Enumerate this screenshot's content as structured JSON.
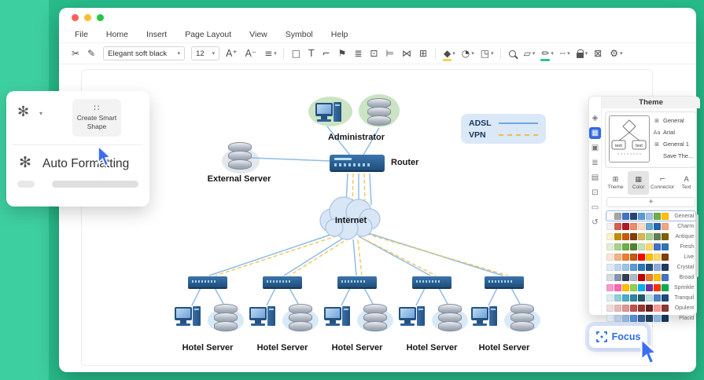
{
  "menu": {
    "items": [
      "File",
      "Home",
      "Insert",
      "Page Layout",
      "View",
      "Symbol",
      "Help"
    ]
  },
  "toolbar": {
    "font_family": "Elegant soft black",
    "font_size": "12",
    "caret": "▾",
    "items_left": [
      {
        "name": "cut-icon",
        "g": "✂",
        "c": ""
      },
      {
        "name": "format-painter-icon",
        "g": "✎",
        "c": ""
      }
    ],
    "items": [
      {
        "name": "increase-font-icon",
        "g": "A⁺",
        "c": ""
      },
      {
        "name": "decrease-font-icon",
        "g": "A⁻",
        "c": ""
      },
      {
        "name": "text-align-icon",
        "g": "≡",
        "c": "▾"
      },
      {
        "name": "toolbar-divider",
        "g": "",
        "c": "",
        "cls": "tb-sep"
      },
      {
        "name": "shape-tool-icon",
        "g": "□",
        "c": ""
      },
      {
        "name": "text-tool-icon",
        "g": "T",
        "c": ""
      },
      {
        "name": "connector-tool-icon",
        "g": "⌐",
        "c": ""
      },
      {
        "name": "flag-tool-icon",
        "g": "⚑",
        "c": ""
      },
      {
        "name": "layers-icon",
        "g": "≣",
        "c": ""
      },
      {
        "name": "select-area-icon",
        "g": "⊡",
        "c": ""
      },
      {
        "name": "align-objects-icon",
        "g": "⊨",
        "c": ""
      },
      {
        "name": "mirror-icon",
        "g": "⋈",
        "c": ""
      },
      {
        "name": "frame-icon",
        "g": "⊞",
        "c": ""
      },
      {
        "name": "toolbar-divider",
        "g": "",
        "c": "",
        "cls": "tb-sep"
      },
      {
        "name": "fill-color-icon",
        "g": "◆",
        "c": "▾",
        "cls": "ic-fill"
      },
      {
        "name": "shadow-icon",
        "g": "◔",
        "c": "▾"
      },
      {
        "name": "crop-icon",
        "g": "◳",
        "c": "▾"
      },
      {
        "name": "toolbar-divider",
        "g": "",
        "c": "",
        "cls": "tb-sep"
      },
      {
        "name": "search-icon",
        "g": "",
        "c": "",
        "cls": "ic-mag"
      },
      {
        "name": "eraser-icon",
        "g": "▱",
        "c": "▾"
      },
      {
        "name": "pen-icon",
        "g": "✏",
        "c": "▾",
        "cls": "ic-pen"
      },
      {
        "name": "line-style-icon",
        "g": "┄",
        "c": "▾"
      },
      {
        "name": "lock-icon",
        "g": "",
        "c": "▾",
        "cls": "ic-lock"
      },
      {
        "name": "export-icon",
        "g": "⊠",
        "c": ""
      },
      {
        "name": "settings-icon",
        "g": "⚙",
        "c": "▾"
      }
    ]
  },
  "smart_popup": {
    "spark_glyph": "✻",
    "caret": "▾",
    "dots_glyph": "∷",
    "create_smart_shape": "Create Smart Shape",
    "auto_formatting": "Auto Formatting"
  },
  "diagram": {
    "administrator": "Administrator",
    "external_server": "External Server",
    "router": "Router",
    "internet": "Internet",
    "adsl": "ADSL",
    "vpn": "VPN",
    "hotel_labels": [
      "Hotel Server",
      "Hotel Server",
      "Hotel Server",
      "Hotel Server",
      "Hotel Server"
    ]
  },
  "theme_panel": {
    "title": "Theme",
    "add_label": "+",
    "preview_shape_text": "text",
    "strip_icons": [
      {
        "name": "symbols-panel-icon",
        "g": "◈"
      },
      {
        "name": "theme-panel-icon",
        "g": "▦",
        "cls": "active"
      },
      {
        "name": "image-panel-icon",
        "g": "▣"
      },
      {
        "name": "layers-panel-icon",
        "g": "≣"
      },
      {
        "name": "notes-panel-icon",
        "g": "▤"
      },
      {
        "name": "selection-panel-icon",
        "g": "⊡"
      },
      {
        "name": "pages-panel-icon",
        "g": "▭"
      },
      {
        "name": "history-panel-icon",
        "g": "↺"
      }
    ],
    "preview_rows": [
      {
        "name": "preview-row-general",
        "g": "⊞",
        "label": "General"
      },
      {
        "name": "preview-row-arial",
        "g": "Aa",
        "label": "Arial"
      },
      {
        "name": "preview-row-general-1",
        "g": "⊞",
        "label": "General 1"
      },
      {
        "name": "preview-row-save-theme",
        "g": "",
        "label": "Save The..."
      }
    ],
    "tabs": [
      {
        "name": "tab-theme",
        "g": "⊞",
        "label": "Theme"
      },
      {
        "name": "tab-color",
        "g": "▦",
        "label": "Color",
        "cls": "active"
      },
      {
        "name": "tab-connector",
        "g": "⌐",
        "label": "Connector"
      },
      {
        "name": "tab-text",
        "g": "A",
        "label": "Text"
      }
    ],
    "palettes": [
      {
        "name": "General",
        "cls": "selected",
        "colors": [
          "#ffffff",
          "#a6a6a6",
          "#4472c4",
          "#264478",
          "#5b9bd5",
          "#9dc3e6",
          "#70ad47",
          "#ffc000"
        ]
      },
      {
        "name": "Charm",
        "colors": [
          "#f2f2f2",
          "#d6604d",
          "#b2182b",
          "#ef8a62",
          "#fddbc7",
          "#67a9cf",
          "#2166ac",
          "#f4a582"
        ]
      },
      {
        "name": "Antique",
        "colors": [
          "#fff2cc",
          "#bf8f00",
          "#c55a11",
          "#833c00",
          "#d6b656",
          "#a9d18e",
          "#667e53",
          "#7f6000"
        ]
      },
      {
        "name": "Fresh",
        "colors": [
          "#e2efda",
          "#a9d18e",
          "#70ad47",
          "#548235",
          "#c5e0b4",
          "#ffd966",
          "#4472c4",
          "#2e75b6"
        ]
      },
      {
        "name": "Live",
        "colors": [
          "#fbe5d6",
          "#f4b183",
          "#ed7d31",
          "#c55a11",
          "#ff0000",
          "#ffc000",
          "#ffd966",
          "#843c0c"
        ]
      },
      {
        "name": "Crystal",
        "colors": [
          "#deebf7",
          "#bdd7ee",
          "#9dc3e6",
          "#5b9bd5",
          "#2e75b6",
          "#1f4e79",
          "#8faadc",
          "#203864"
        ]
      },
      {
        "name": "Broad",
        "colors": [
          "#d6dce5",
          "#8496b0",
          "#333f50",
          "#adb9ca",
          "#c00000",
          "#ed7d31",
          "#ffc000",
          "#4472c4"
        ]
      },
      {
        "name": "Sprinkle",
        "colors": [
          "#ff99cc",
          "#ff66b3",
          "#ffc000",
          "#92d050",
          "#00b0f0",
          "#7030a0",
          "#ff3300",
          "#00b050"
        ]
      },
      {
        "name": "Tranquil",
        "colors": [
          "#daeef3",
          "#92cddc",
          "#4bacc6",
          "#31859c",
          "#215968",
          "#b7dee8",
          "#4f81bd",
          "#1f497d"
        ]
      },
      {
        "name": "Opulent",
        "colors": [
          "#f2dcdb",
          "#e6b9b8",
          "#d99694",
          "#c0504d",
          "#953735",
          "#632423",
          "#ff9999",
          "#8c3836"
        ]
      },
      {
        "name": "Placid",
        "colors": [
          "#dce6f1",
          "#b8cce4",
          "#95b3d7",
          "#538dd5",
          "#366092",
          "#244062",
          "#8db4e2",
          "#16365c"
        ]
      }
    ]
  },
  "focus": {
    "label": "Focus"
  }
}
